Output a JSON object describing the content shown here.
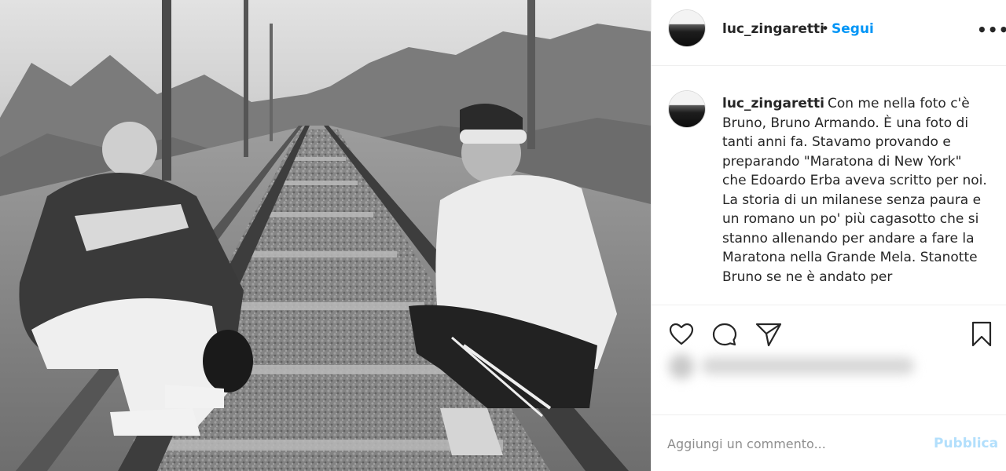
{
  "post": {
    "username": "luc_zingaretti",
    "separator": "•",
    "follow_label": "Segui",
    "more_label": "•••",
    "caption": "Con me nella foto c'è Bruno, Bruno Armando. È una foto di tanti anni fa. Stavamo provando e preparando \"Maratona di New York\" che Edoardo Erba aveva scritto per noi. La storia di un milanese senza paura e un romano un po' più cagasotto che si stanno allenando per andare a fare la Maratona nella Grande Mela. Stanotte Bruno se ne è andato per"
  },
  "photo": {
    "description_icon": "black-and-white-photo",
    "colors": {
      "sky": "#d8d8d8",
      "gravel": "#7f7f7f",
      "rail": "#4a4a4a"
    }
  },
  "actions": {
    "like_icon": "heart-icon",
    "comment_icon": "comment-bubble-icon",
    "share_icon": "paper-plane-icon",
    "save_icon": "bookmark-icon"
  },
  "comment": {
    "placeholder": "Aggiungi un commento...",
    "publish_label": "Pubblica"
  },
  "colors": {
    "accent": "#0095f6",
    "publish_disabled": "#b2dffc",
    "text": "#262626",
    "muted": "#8e8e8e",
    "border": "#efefef"
  }
}
